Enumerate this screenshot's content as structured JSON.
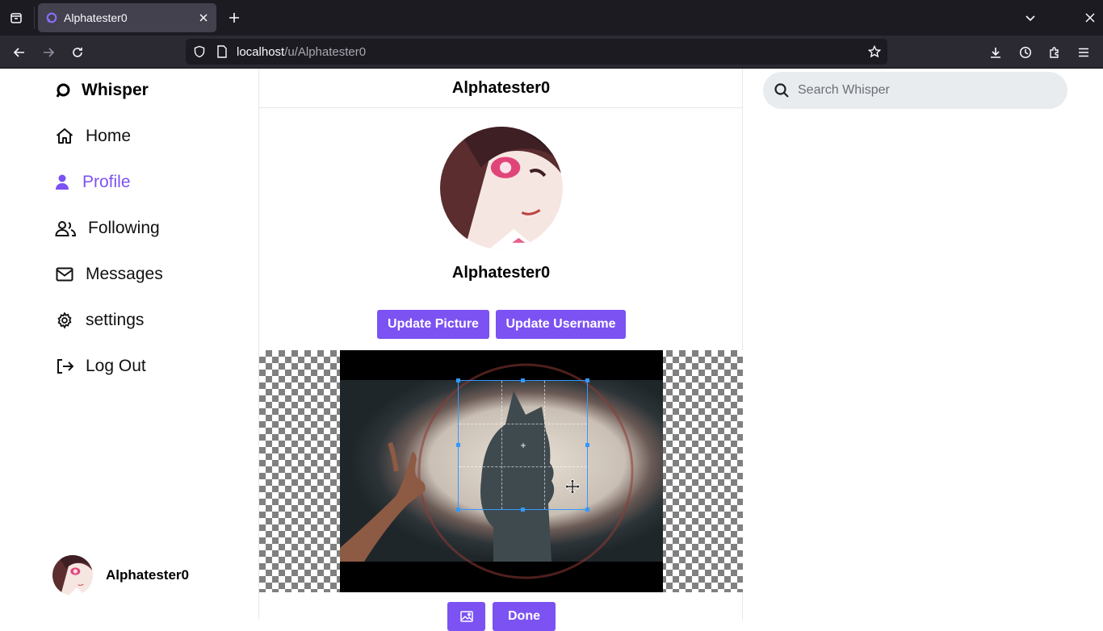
{
  "browser": {
    "tab_title": "Alphatester0",
    "url_host": "localhost",
    "url_path": "/u/Alphatester0"
  },
  "sidebar": {
    "brand": "Whisper",
    "items": [
      {
        "label": "Home",
        "icon": "home-icon"
      },
      {
        "label": "Profile",
        "icon": "user-icon",
        "active": true
      },
      {
        "label": "Following",
        "icon": "users-icon"
      },
      {
        "label": "Messages",
        "icon": "envelope-icon"
      },
      {
        "label": "settings",
        "icon": "gear-icon"
      },
      {
        "label": "Log Out",
        "icon": "logout-icon"
      }
    ],
    "user": {
      "username": "Alphatester0"
    }
  },
  "main": {
    "header_title": "Alphatester0",
    "profile_name": "Alphatester0",
    "update_picture_label": "Update Picture",
    "update_username_label": "Update Username",
    "done_label": "Done",
    "image_button_icon": "image-icon"
  },
  "search": {
    "placeholder": "Search Whisper"
  },
  "colors": {
    "accent": "#7c52f2",
    "crop_border": "#3399ff"
  }
}
